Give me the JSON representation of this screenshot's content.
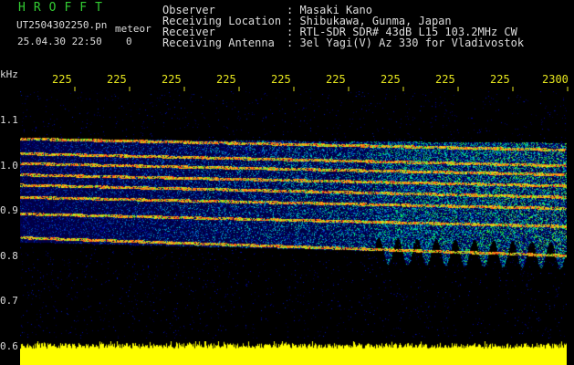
{
  "header": {
    "logo": "HROFFT",
    "filename": "UT2504302250.pn",
    "meteor_label": "meteor",
    "datetime": "25.04.30 22:50",
    "count": "0",
    "info": [
      {
        "key": "Observer",
        "value": ": Masaki Kano"
      },
      {
        "key": "Receiving Location",
        "value": ": Shibukawa, Gunma, Japan"
      },
      {
        "key": "Receiver",
        "value": ": RTL-SDR SDR# 43dB L15 103.2MHz CW"
      },
      {
        "key": "Receiving Antenna",
        "value": ": 3el Yagi(V) Az 330 for Vladivostok"
      }
    ]
  },
  "axes": {
    "y_unit": "kHz",
    "y_ticks": [
      "1.1",
      "1.0",
      "0.9",
      "0.8",
      "0.7",
      "0.6"
    ],
    "x_ticks": [
      "225",
      "225",
      "225",
      "225",
      "225",
      "225",
      "225",
      "225",
      "225",
      "2300"
    ]
  },
  "colors": {
    "background": "#000000",
    "header_text": "#dcdcdc",
    "logo": "#33cc33",
    "time_ticks": "#e6e61e",
    "amplitude": "#ffff00"
  },
  "spectrogram": {
    "freq_range_khz": [
      0.6,
      1.15
    ],
    "meteor_traces_khz": [
      [
        1.045,
        1.02
      ],
      [
        1.012,
        0.985
      ],
      [
        0.99,
        0.965
      ],
      [
        0.965,
        0.94
      ],
      [
        0.942,
        0.915
      ],
      [
        0.915,
        0.89
      ],
      [
        0.878,
        0.85
      ],
      [
        0.825,
        0.785
      ]
    ],
    "noise_band_khz": [
      0.815,
      1.045
    ]
  }
}
